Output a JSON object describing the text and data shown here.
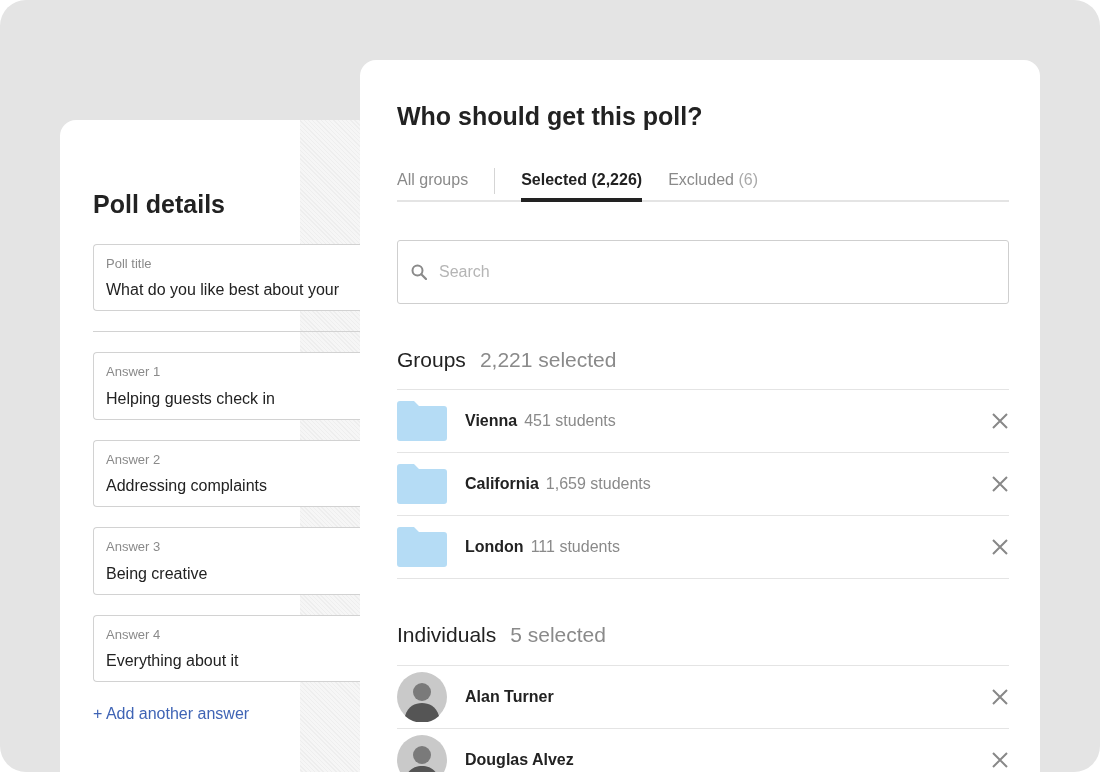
{
  "poll_details": {
    "title": "Poll details",
    "fields": [
      {
        "label": "Poll title",
        "value": "What do you like best about your"
      },
      {
        "label": "Answer 1",
        "value": "Helping guests check in"
      },
      {
        "label": "Answer 2",
        "value": "Addressing complaints"
      },
      {
        "label": "Answer 3",
        "value": "Being creative"
      },
      {
        "label": "Answer 4",
        "value": "Everything about it"
      }
    ],
    "add_link": "+ Add another answer"
  },
  "recipients": {
    "title": "Who should get this poll?",
    "tabs": [
      {
        "label": "All groups",
        "selected": false
      },
      {
        "label": "Selected",
        "count": "(2,226)",
        "selected": true
      },
      {
        "label": "Excluded",
        "count": "(6)",
        "selected": false
      }
    ],
    "search": {
      "placeholder": "Search"
    },
    "sections": [
      {
        "title": "Groups",
        "summary": "2,221 selected",
        "kind": "group",
        "items": [
          {
            "name": "Vienna",
            "detail": "451 students"
          },
          {
            "name": "California",
            "detail": "1,659 students"
          },
          {
            "name": "London",
            "detail": "111 students"
          }
        ]
      },
      {
        "title": "Individuals",
        "summary": "5 selected",
        "kind": "person",
        "items": [
          {
            "name": "Alan Turner"
          },
          {
            "name": "Douglas Alvez"
          }
        ]
      }
    ]
  }
}
